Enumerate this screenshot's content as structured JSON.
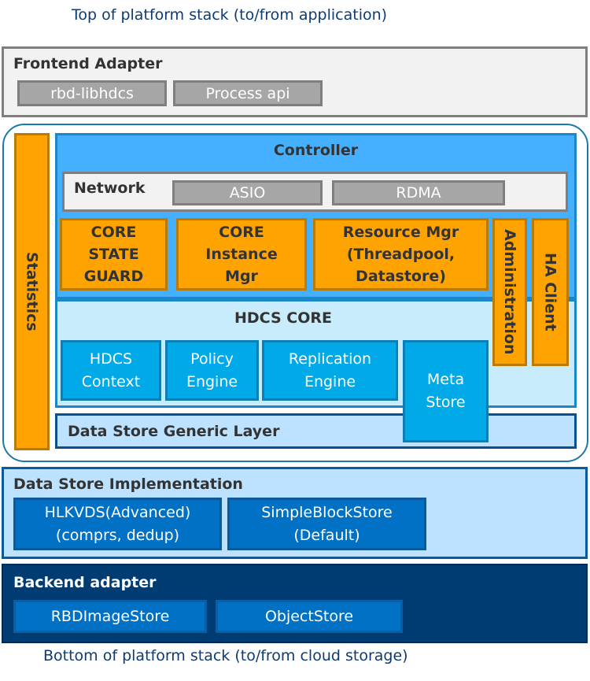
{
  "captions": {
    "top": "Top of platform stack  (to/from application)",
    "bottom": "Bottom of platform stack (to/from cloud storage)"
  },
  "frontend": {
    "title": "Frontend  Adapter",
    "items": [
      "rbd-libhdcs",
      "Process api"
    ]
  },
  "statistics": {
    "label": "Statistics"
  },
  "controller": {
    "title": "Controller",
    "network": {
      "title": "Network",
      "items": [
        "ASIO",
        "RDMA"
      ]
    },
    "modules": [
      {
        "lines": [
          "CORE",
          "STATE",
          "GUARD"
        ]
      },
      {
        "lines": [
          "CORE",
          "Instance",
          "Mgr"
        ]
      },
      {
        "lines": [
          "Resource Mgr",
          "(Threadpool,",
          "Datastore)"
        ]
      }
    ],
    "administration": "Administration",
    "ha_client": "HA Client"
  },
  "hdcs_core": {
    "title": "HDCS CORE",
    "modules": [
      {
        "lines": [
          "HDCS",
          "Context"
        ]
      },
      {
        "lines": [
          "Policy",
          "Engine"
        ]
      },
      {
        "lines": [
          "Replication",
          "Engine"
        ]
      }
    ],
    "meta_store": {
      "lines": [
        "Meta",
        "Store"
      ]
    }
  },
  "data_store_generic_layer": {
    "title": "Data Store Generic Layer"
  },
  "data_store_implementation": {
    "title": "Data Store Implementation",
    "items": [
      {
        "lines": [
          "HLKVDS(Advanced)",
          "(comprs, dedup)"
        ]
      },
      {
        "lines": [
          "SimpleBlockStore",
          "(Default)"
        ]
      }
    ]
  },
  "backend": {
    "title": "Backend adapter",
    "items": [
      "RBDImageStore",
      "ObjectStore"
    ]
  },
  "colors": {
    "caption": "#0d3b72",
    "frontend_bg": "#f2f2f2",
    "gray_chip": "#a6a6a6",
    "orange": "#ffa300",
    "controller_bg": "#45b0ff",
    "hdcs_core_bg": "#c8ecfc",
    "cyan_box": "#00a9e8",
    "light_blue": "#bde2ff",
    "blue_box": "#0071c5",
    "backend_bg": "#003c71"
  }
}
